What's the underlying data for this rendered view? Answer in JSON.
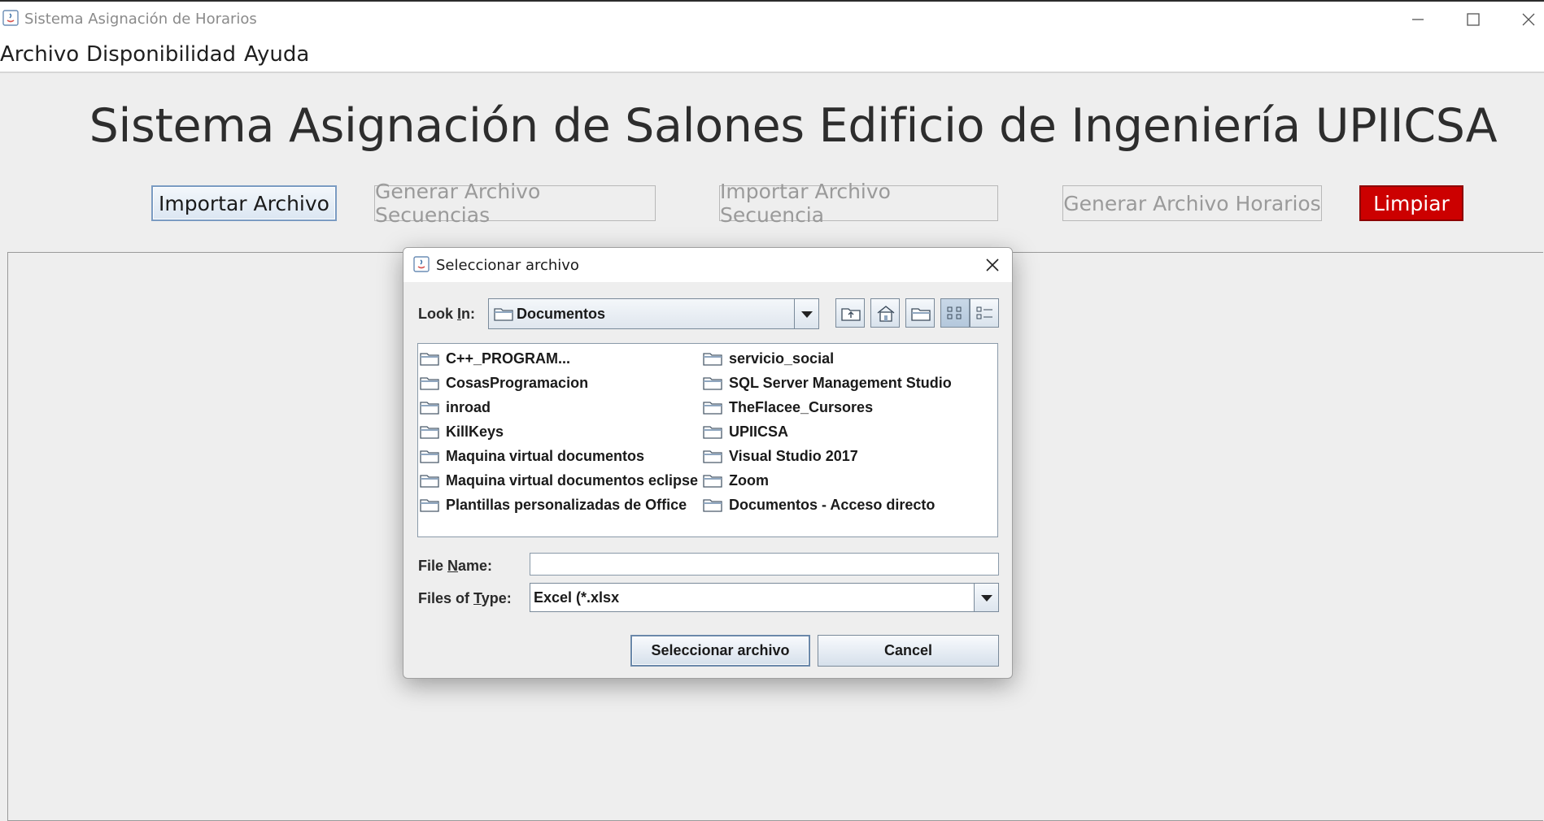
{
  "window": {
    "title": "Sistema Asignación de Horarios"
  },
  "menubar": {
    "items": [
      "Archivo",
      "Disponibilidad",
      "Ayuda"
    ]
  },
  "main": {
    "heading": "Sistema Asignación de Salones Edificio de Ingeniería UPIICSA",
    "buttons": {
      "import_file": "Importar Archivo",
      "generate_sequences": "Generar Archivo Secuencias",
      "import_sequence": "Importar Archivo Secuencia",
      "generate_schedules": "Generar Archivo Horarios",
      "clear": "Limpiar"
    },
    "colors": {
      "clear_button": "#cc0000"
    }
  },
  "dialog": {
    "title": "Seleccionar archivo",
    "look_in_label_pre": "Look ",
    "look_in_label_mnemonic": "I",
    "look_in_label_post": "n:",
    "look_in_value": "Documentos",
    "toolbar_icons": [
      "up-one-level-icon",
      "home-icon",
      "new-folder-icon",
      "list-view-icon",
      "details-view-icon"
    ],
    "files_col1": [
      "C++_PROGRAM...",
      "CosasProgramacion",
      "inroad",
      "KillKeys",
      "Maquina virtual documentos",
      "Maquina virtual documentos eclipse",
      "Plantillas personalizadas de Office"
    ],
    "files_col2": [
      "servicio_social",
      "SQL Server Management Studio",
      "TheFlacee_Cursores",
      "UPIICSA",
      "Visual Studio 2017",
      "Zoom",
      "Documentos - Acceso directo"
    ],
    "file_name_label_pre": "File ",
    "file_name_label_mnemonic": "N",
    "file_name_label_post": "ame:",
    "file_name_value": "",
    "file_type_label_pre": "Files of ",
    "file_type_label_mnemonic": "T",
    "file_type_label_post": "ype:",
    "file_type_value": "Excel (*.xlsx",
    "approve_button": "Seleccionar archivo",
    "cancel_button": "Cancel"
  }
}
